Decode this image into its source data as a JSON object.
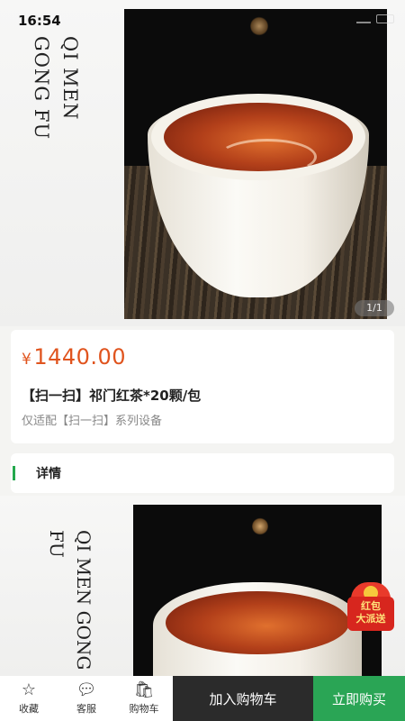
{
  "status_bar": {
    "time": "16:54"
  },
  "hero": {
    "vertical_text": "QI MEN GONG FU",
    "page_indicator": "1/1"
  },
  "product": {
    "currency": "¥",
    "price": "1440.00",
    "title": "【扫一扫】祁门红茶*20颗/包",
    "subtitle": "仅适配【扫一扫】系列设备"
  },
  "details": {
    "label": "详情"
  },
  "detail_image": {
    "vertical_text": "QI MEN GONG FU"
  },
  "red_packet": {
    "line1": "红包",
    "line2": "大派送"
  },
  "bottom_bar": {
    "tabs": [
      {
        "label": "收藏",
        "icon": "star-icon"
      },
      {
        "label": "客服",
        "icon": "chat-icon"
      },
      {
        "label": "购物车",
        "icon": "cart-icon"
      }
    ],
    "add_to_cart": "加入购物车",
    "buy_now": "立即购买"
  },
  "colors": {
    "price": "#e0541e",
    "accent_green": "#2aa555",
    "cart_button": "#2b2b2b"
  }
}
